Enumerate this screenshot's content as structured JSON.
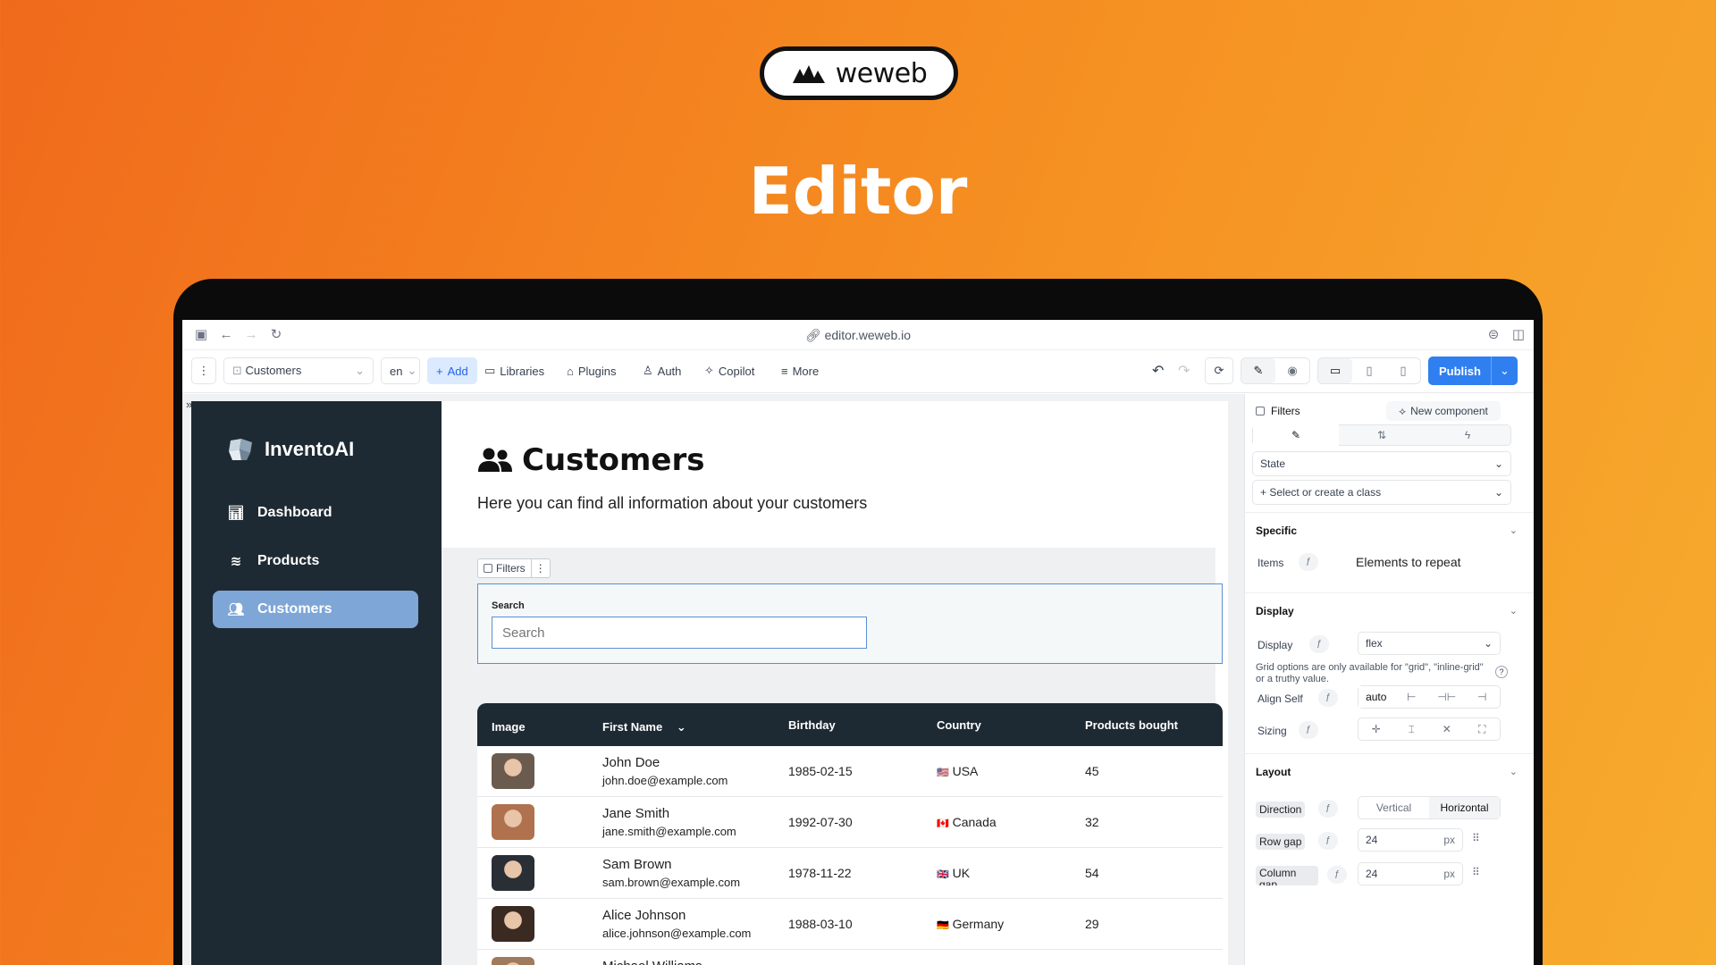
{
  "brand": {
    "name": "weweb"
  },
  "hero": {
    "title": "Editor"
  },
  "browser": {
    "url": "editor.weweb.io"
  },
  "toolbar": {
    "page_select": "Customers",
    "lang": "en",
    "add": "Add",
    "libraries": "Libraries",
    "plugins": "Plugins",
    "auth": "Auth",
    "copilot": "Copilot",
    "more": "More",
    "publish": "Publish"
  },
  "app": {
    "brand": "InventoAI",
    "nav": [
      {
        "label": "Dashboard",
        "icon": "bar-chart-icon"
      },
      {
        "label": "Products",
        "icon": "layers-icon"
      },
      {
        "label": "Customers",
        "icon": "users-icon",
        "active": true
      }
    ],
    "title": "Customers",
    "subtitle": "Here you can find all information about your customers",
    "filters_chip": "Filters",
    "search_label": "Search",
    "search_placeholder": "Search",
    "table": {
      "columns": [
        "Image",
        "First Name",
        "Birthday",
        "Country",
        "Products bought"
      ],
      "rows": [
        {
          "name": "John Doe",
          "email": "john.doe@example.com",
          "birthday": "1985-02-15",
          "flag": "🇺🇸",
          "country": "USA",
          "products": "45",
          "avatar_color": "#6b5a4e"
        },
        {
          "name": "Jane Smith",
          "email": "jane.smith@example.com",
          "birthday": "1992-07-30",
          "flag": "🇨🇦",
          "country": "Canada",
          "products": "32",
          "avatar_color": "#b0714f"
        },
        {
          "name": "Sam Brown",
          "email": "sam.brown@example.com",
          "birthday": "1978-11-22",
          "flag": "🇬🇧",
          "country": "UK",
          "products": "54",
          "avatar_color": "#2a2f36"
        },
        {
          "name": "Alice Johnson",
          "email": "alice.johnson@example.com",
          "birthday": "1988-03-10",
          "flag": "🇩🇪",
          "country": "Germany",
          "products": "29",
          "avatar_color": "#3b2a22"
        },
        {
          "name": "Michael Williams",
          "email": "",
          "birthday": "",
          "flag": "",
          "country": "",
          "products": "",
          "avatar_color": "#a07a5c"
        }
      ]
    }
  },
  "panel": {
    "filters": "Filters",
    "new_component": "New component",
    "state": "State",
    "class_select": "Select or create a class",
    "specific": "Specific",
    "items_label": "Items",
    "items_value": "Elements to repeat",
    "display_section": "Display",
    "display_label": "Display",
    "display_value": "flex",
    "grid_note": "Grid options are only available for \"grid\", \"inline-grid\" or a truthy value.",
    "align_self": "Align Self",
    "align_value": "auto",
    "sizing": "Sizing",
    "layout": "Layout",
    "direction": "Direction",
    "vertical": "Vertical",
    "horizontal": "Horizontal",
    "row_gap": "Row gap",
    "row_gap_value": "24",
    "column_gap": "Column gap",
    "column_gap_value": "24",
    "unit": "px"
  }
}
